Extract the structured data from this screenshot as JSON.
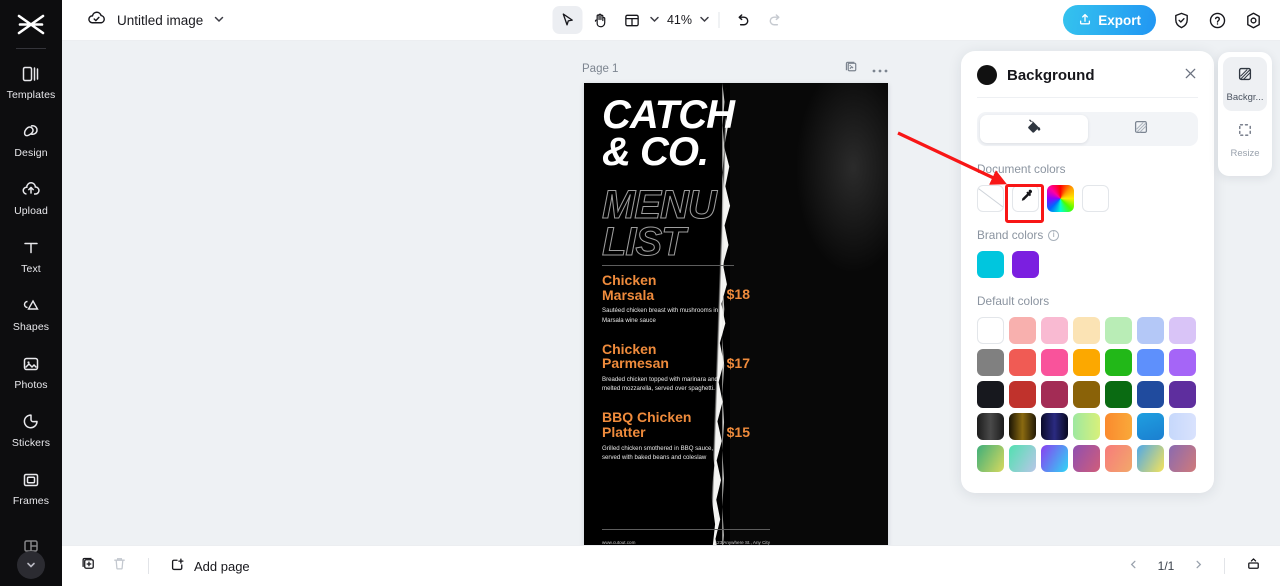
{
  "sidebar": {
    "logo": "cutout-logo",
    "items": [
      {
        "label": "Templates",
        "icon": "templates-icon"
      },
      {
        "label": "Design",
        "icon": "design-icon"
      },
      {
        "label": "Upload",
        "icon": "upload-icon"
      },
      {
        "label": "Text",
        "icon": "text-icon"
      },
      {
        "label": "Shapes",
        "icon": "shapes-icon"
      },
      {
        "label": "Photos",
        "icon": "photos-icon"
      },
      {
        "label": "Stickers",
        "icon": "stickers-icon"
      },
      {
        "label": "Frames",
        "icon": "frames-icon"
      }
    ]
  },
  "topbar": {
    "cloud_status_icon": "cloud-check-icon",
    "doc_title": "Untitled image",
    "title_chevron": "chevron-down-icon",
    "tools": [
      {
        "name": "select-tool",
        "icon": "cursor-icon",
        "active": true
      },
      {
        "name": "hand-tool",
        "icon": "hand-icon",
        "active": false
      },
      {
        "name": "layout-tool",
        "icon": "layout-icon",
        "active": false
      }
    ],
    "zoom_level": "41%",
    "undo": "undo-icon",
    "redo": "redo-icon",
    "export_label": "Export",
    "export_icon": "export-upload-icon",
    "right_icons": [
      "shield-check-icon",
      "help-icon",
      "settings-icon"
    ]
  },
  "canvas": {
    "page_label": "Page 1",
    "duplicate_icon": "duplicate-page-icon",
    "more_icon": "more-options-icon",
    "poster": {
      "title_line1": "CATCH",
      "title_line2": "& CO.",
      "title_line3": "MENU",
      "title_line4": "LIST",
      "items": [
        {
          "name": "Chicken Marsala",
          "price": "$18",
          "desc": "Sautéed chicken breast with mushrooms in Marsala wine sauce"
        },
        {
          "name": "Chicken Parmesan",
          "price": "$17",
          "desc": "Breaded chicken topped with marinara and melted mozzarella, served over spaghetti."
        },
        {
          "name": "BBQ Chicken Platter",
          "price": "$15",
          "desc": "Grilled chicken smothered in BBQ sauce, served with baked beans and coleslaw"
        }
      ],
      "footer_site": "www.cutout.com",
      "footer_address": "123 Anywhere St., Any City",
      "accent_color": "#EF8B3C"
    }
  },
  "bg_panel": {
    "title": "Background",
    "swatch_color": "#111111",
    "close_icon": "close-icon",
    "tabs": [
      {
        "name": "fill-tab",
        "icon": "paint-bucket-icon",
        "active": true
      },
      {
        "name": "transparency-tab",
        "icon": "transparency-icon",
        "active": false
      }
    ],
    "document_colors_label": "Document colors",
    "document_colors": [
      {
        "name": "none-swatch",
        "value": "none"
      },
      {
        "name": "eyedropper-swatch",
        "value": "eyedropper",
        "highlighted": true
      },
      {
        "name": "color-wheel-swatch",
        "value": "wheel"
      },
      {
        "name": "white-swatch",
        "value": "#FFFFFF"
      }
    ],
    "brand_colors_label": "Brand colors",
    "brand_info_icon": "info-icon",
    "brand_colors": [
      "#00C6DE",
      "#7B1FE0"
    ],
    "default_colors_label": "Default colors",
    "default_colors": [
      [
        "#FFFFFF",
        "#F8B0AE",
        "#F9BAD2",
        "#FBE3B4",
        "#B9EDB6",
        "#B4C8F7",
        "#D9C4F7"
      ],
      [
        "#808080",
        "#F05B54",
        "#F9539B",
        "#FCA800",
        "#22B818",
        "#5E90FC",
        "#A565F7"
      ],
      [
        "#17181E",
        "#C0322C",
        "#A32C55",
        "#8A6208",
        "#0A6B12",
        "#204B9E",
        "#5E2E9E"
      ],
      [
        "linear-gradient(90deg,#1c1c1c,#4a4a4a,#1c1c1c)",
        "linear-gradient(90deg,#1a1405,#8a6a10,#241a06)",
        "linear-gradient(90deg,#0b0b2a,#2a2a80,#08081f)",
        "linear-gradient(90deg,#9ee8a0,#d8f07a)",
        "linear-gradient(90deg,#fb8a2e,#f9a93a)",
        "linear-gradient(160deg,#1f9fe0,#1b7fd0)",
        "linear-gradient(90deg,#c6d8fb,#d9e2fd)"
      ],
      [
        "linear-gradient(120deg,#3fae7a,#d7d95e)",
        "linear-gradient(120deg,#52e0b0,#b9c6e8)",
        "linear-gradient(120deg,#8a3ff0,#2fd7f5)",
        "linear-gradient(120deg,#8f4fb0,#d05d7a)",
        "linear-gradient(120deg,#f77b7b,#f2a86a)",
        "linear-gradient(120deg,#4fa8e8,#f5e35a)",
        "linear-gradient(120deg,#8a6ab0,#d07a7a)"
      ]
    ]
  },
  "right_rail": [
    {
      "label": "Backgr...",
      "icon": "background-icon",
      "active": true
    },
    {
      "label": "Resize",
      "icon": "resize-icon",
      "active": false
    }
  ],
  "bottombar": {
    "duplicate_icon": "duplicate-page-icon",
    "delete_icon": "trash-icon",
    "add_page_label": "Add page",
    "add_page_icon": "add-page-icon",
    "prev_icon": "chevron-left-icon",
    "page_indicator": "1/1",
    "next_icon": "chevron-right-icon",
    "present_icon": "present-icon"
  }
}
